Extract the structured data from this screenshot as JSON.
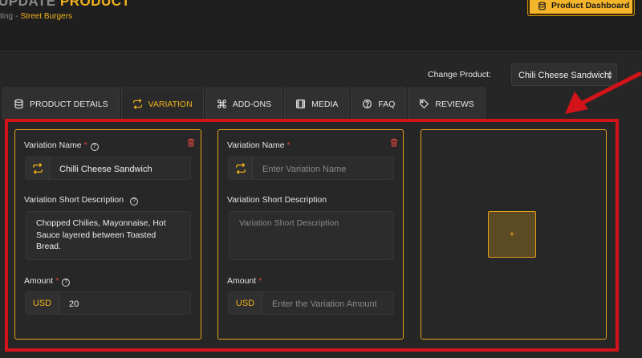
{
  "header": {
    "title_part1": "UPDATE",
    "title_part2": "PRODUCT",
    "breadcrumb_parent": "ting",
    "breadcrumb_sep": "-",
    "breadcrumb_current": "Street Burgers",
    "dashboard_button": "Product Dashboard"
  },
  "change_product": {
    "label": "Change Product:",
    "value": "Chili Cheese Sandwich"
  },
  "tabs": [
    {
      "label": "PRODUCT DETAILS",
      "active": false
    },
    {
      "label": "VARIATION",
      "active": true
    },
    {
      "label": "ADD-ONS",
      "active": false
    },
    {
      "label": "MEDIA",
      "active": false
    },
    {
      "label": "FAQ",
      "active": false
    },
    {
      "label": "REVIEWS",
      "active": false
    }
  ],
  "variations": [
    {
      "name_label": "Variation Name",
      "required": "*",
      "name_value": "Chilli Cheese Sandwich",
      "desc_label": "Variation Short Description",
      "desc_value": "Chopped Chilies, Mayonnaise, Hot Sauce layered between Toasted Bread.",
      "amount_label": "Amount",
      "currency": "USD",
      "amount_value": "20"
    },
    {
      "name_label": "Variation Name",
      "required": "*",
      "name_placeholder": "Enter Variation Name",
      "desc_label": "Variation Short Description",
      "desc_placeholder": "Variation Short Description",
      "amount_label": "Amount",
      "currency": "USD",
      "amount_placeholder": "Enter the Variation Amount"
    }
  ],
  "add_variation_button": "+",
  "colors": {
    "accent": "#f2b21b",
    "highlight_frame": "#d3131a",
    "background": "#262626",
    "required": "#e0453f"
  },
  "icons": {
    "dashboard": "database-icon",
    "tabs": [
      "database-icon",
      "swap-arrows-icon",
      "command-icon",
      "film-icon",
      "question-circle-icon",
      "tag-icon"
    ],
    "variation_name": "swap-arrows-icon",
    "delete": "trash-icon"
  }
}
